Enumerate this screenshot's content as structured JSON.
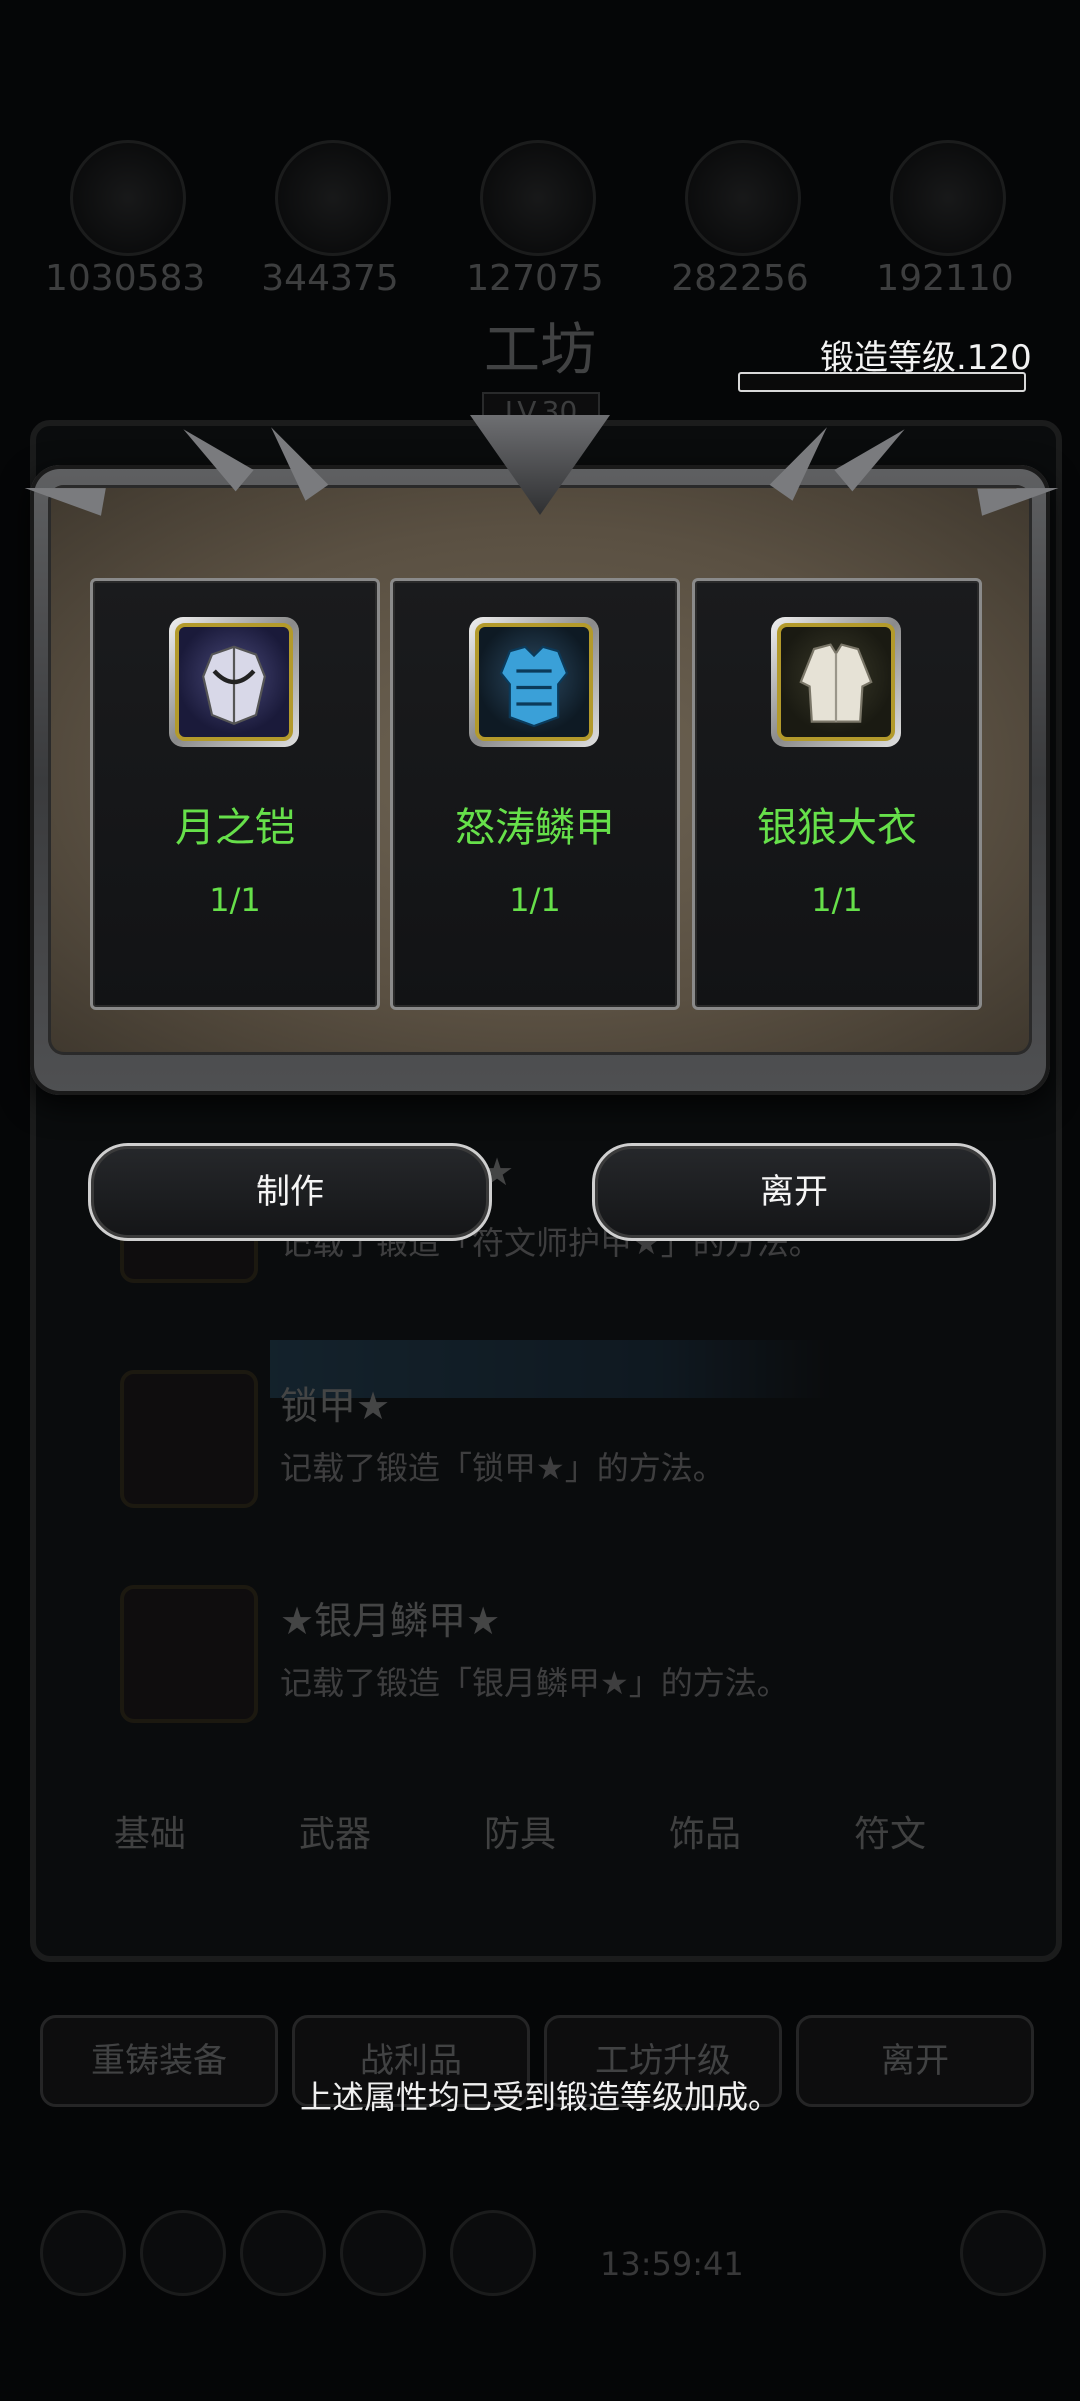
{
  "background": {
    "resources": [
      "1030583",
      "344375",
      "127075",
      "282256",
      "192110"
    ],
    "title": "工坊",
    "level_badge": "LV.30",
    "recipes": [
      {
        "title": "★",
        "desc": "记载了锻造「符文师护甲★」的方法。"
      },
      {
        "title": "锁甲★",
        "desc": "记载了锻造「锁甲★」的方法。"
      },
      {
        "title": "★银月鳞甲★",
        "desc": "记载了锻造「银月鳞甲★」的方法。"
      }
    ],
    "tabs": [
      "基础",
      "武器",
      "防具",
      "饰品",
      "符文"
    ],
    "buttons": [
      "重铸装备",
      "战利品",
      "工坊升级",
      "离开"
    ],
    "timer": "13:59:41"
  },
  "forge": {
    "level_label": "锻造等级.120",
    "progress": 0.0
  },
  "items": [
    {
      "name": "月之铠",
      "count": "1/1",
      "icon": "moon-armor-icon"
    },
    {
      "name": "怒涛鳞甲",
      "count": "1/1",
      "icon": "raging-scale-armor-icon"
    },
    {
      "name": "银狼大衣",
      "count": "1/1",
      "icon": "silver-wolf-coat-icon"
    }
  ],
  "actions": {
    "craft": "制作",
    "leave": "离开"
  },
  "notice": "上述属性均已受到锻造等级加成。",
  "colors": {
    "item_name": "#66e04a",
    "item_border": "#b39a2b"
  }
}
